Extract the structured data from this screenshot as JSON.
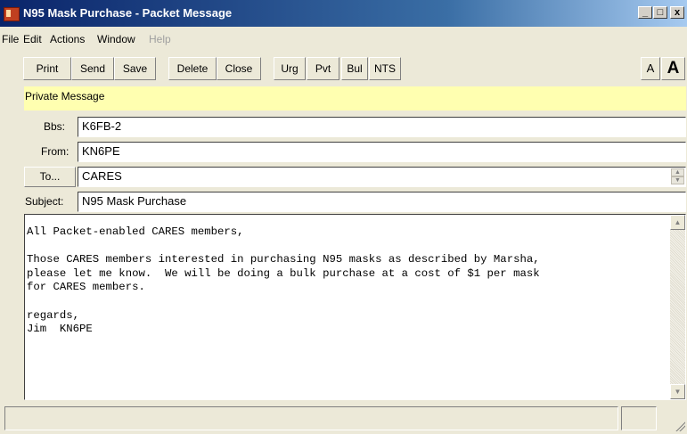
{
  "window": {
    "title": "N95 Mask Purchase - Packet Message",
    "controls": {
      "minimize": "_",
      "maximize": "□",
      "close": "x"
    }
  },
  "menu": [
    "File",
    "Edit",
    "Actions",
    "Window",
    "Help"
  ],
  "toolbar": {
    "print": "Print",
    "send": "Send",
    "save": "Save",
    "delete": "Delete",
    "close": "Close",
    "urg": "Urg",
    "pvt": "Pvt",
    "bul": "Bul",
    "nts": "NTS",
    "font_small": "A",
    "font_large": "A"
  },
  "banner": "Private Message",
  "fields": {
    "bbs_label": "Bbs:",
    "bbs_value": "K6FB-2",
    "from_label": "From:",
    "from_value": "KN6PE",
    "to_label": "To...",
    "to_value": "CARES",
    "subject_label": "Subject:",
    "subject_value": "N95 Mask Purchase"
  },
  "message_body": "All Packet-enabled CARES members,\n\nThose CARES members interested in purchasing N95 masks as described by Marsha,\nplease let me know.  We will be doing a bulk purchase at a cost of $1 per mask\nfor CARES members.\n\nregards,\nJim  KN6PE",
  "colors": {
    "banner": "#ffffb0",
    "titlebar": "#0a246a",
    "chrome": "#ece9d8"
  }
}
